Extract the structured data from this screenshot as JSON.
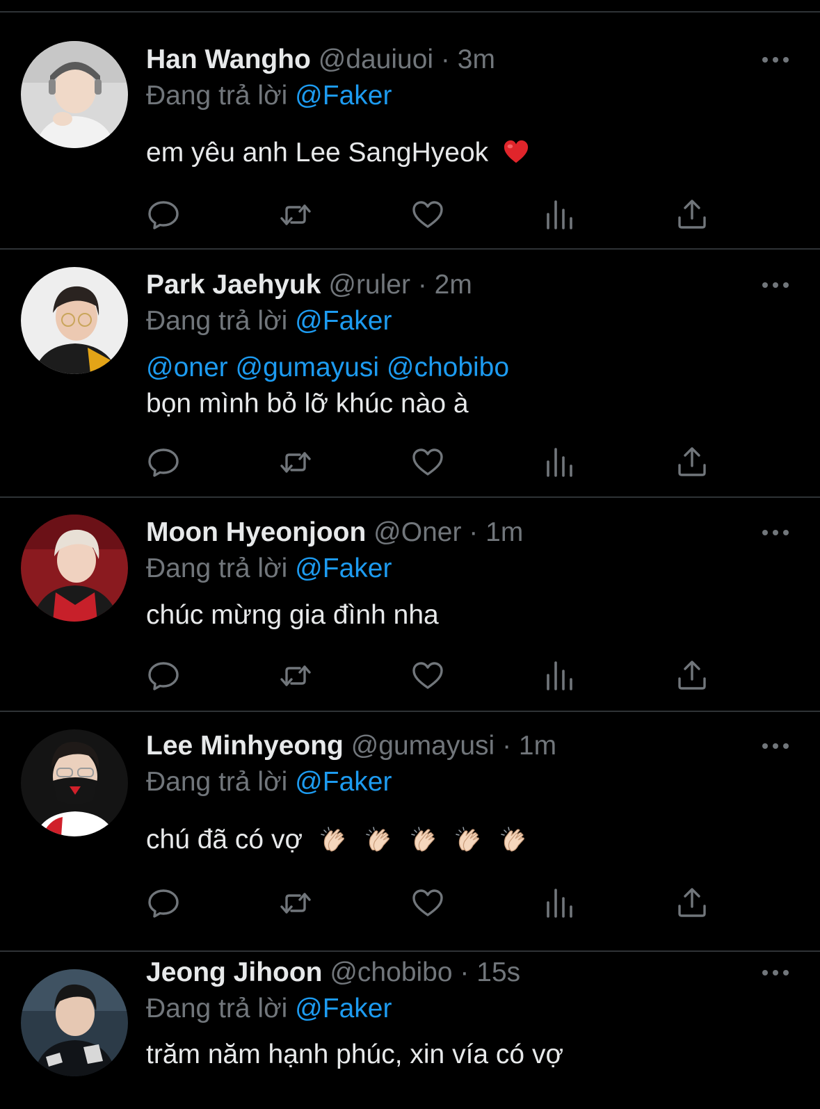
{
  "reply_prefix": "Đang trả lời",
  "tweets": [
    {
      "name": "Han Wangho",
      "handle": "@dauiuoi",
      "dot": "·",
      "time": "3m",
      "replying_to": "@Faker",
      "text": "em yêu anh Lee SangHyeok",
      "emoji": "red-heart-emoji"
    },
    {
      "name": "Park Jaehyuk",
      "handle": "@ruler",
      "dot": "·",
      "time": "2m",
      "replying_to": "@Faker",
      "mentions": [
        "@oner",
        "@gumayusi",
        "@chobibo"
      ],
      "text": "bọn mình bỏ lỡ khúc nào à"
    },
    {
      "name": "Moon Hyeonjoon",
      "handle": "@Oner",
      "dot": "·",
      "time": "1m",
      "replying_to": "@Faker",
      "text": "chúc mừng gia đình nha"
    },
    {
      "name": "Lee Minhyeong",
      "handle": "@gumayusi",
      "dot": "·",
      "time": "1m",
      "replying_to": "@Faker",
      "text": "chú đã có vợ",
      "emoji": "clapping-hands-emoji",
      "emoji_count": 5
    },
    {
      "name": "Jeong Jihoon",
      "handle": "@chobibo",
      "dot": "·",
      "time": "15s",
      "replying_to": "@Faker",
      "text": "trăm năm hạnh phúc, xin vía có vợ"
    }
  ],
  "icons": {
    "reply": "reply-icon",
    "retweet": "retweet-icon",
    "like": "like-icon",
    "views": "views-icon",
    "share": "share-icon",
    "more": "more-icon"
  },
  "colors": {
    "background": "#000000",
    "text": "#e7e9ea",
    "secondary": "#71767b",
    "mention": "#1d9bf0",
    "divider": "#2f3336"
  }
}
